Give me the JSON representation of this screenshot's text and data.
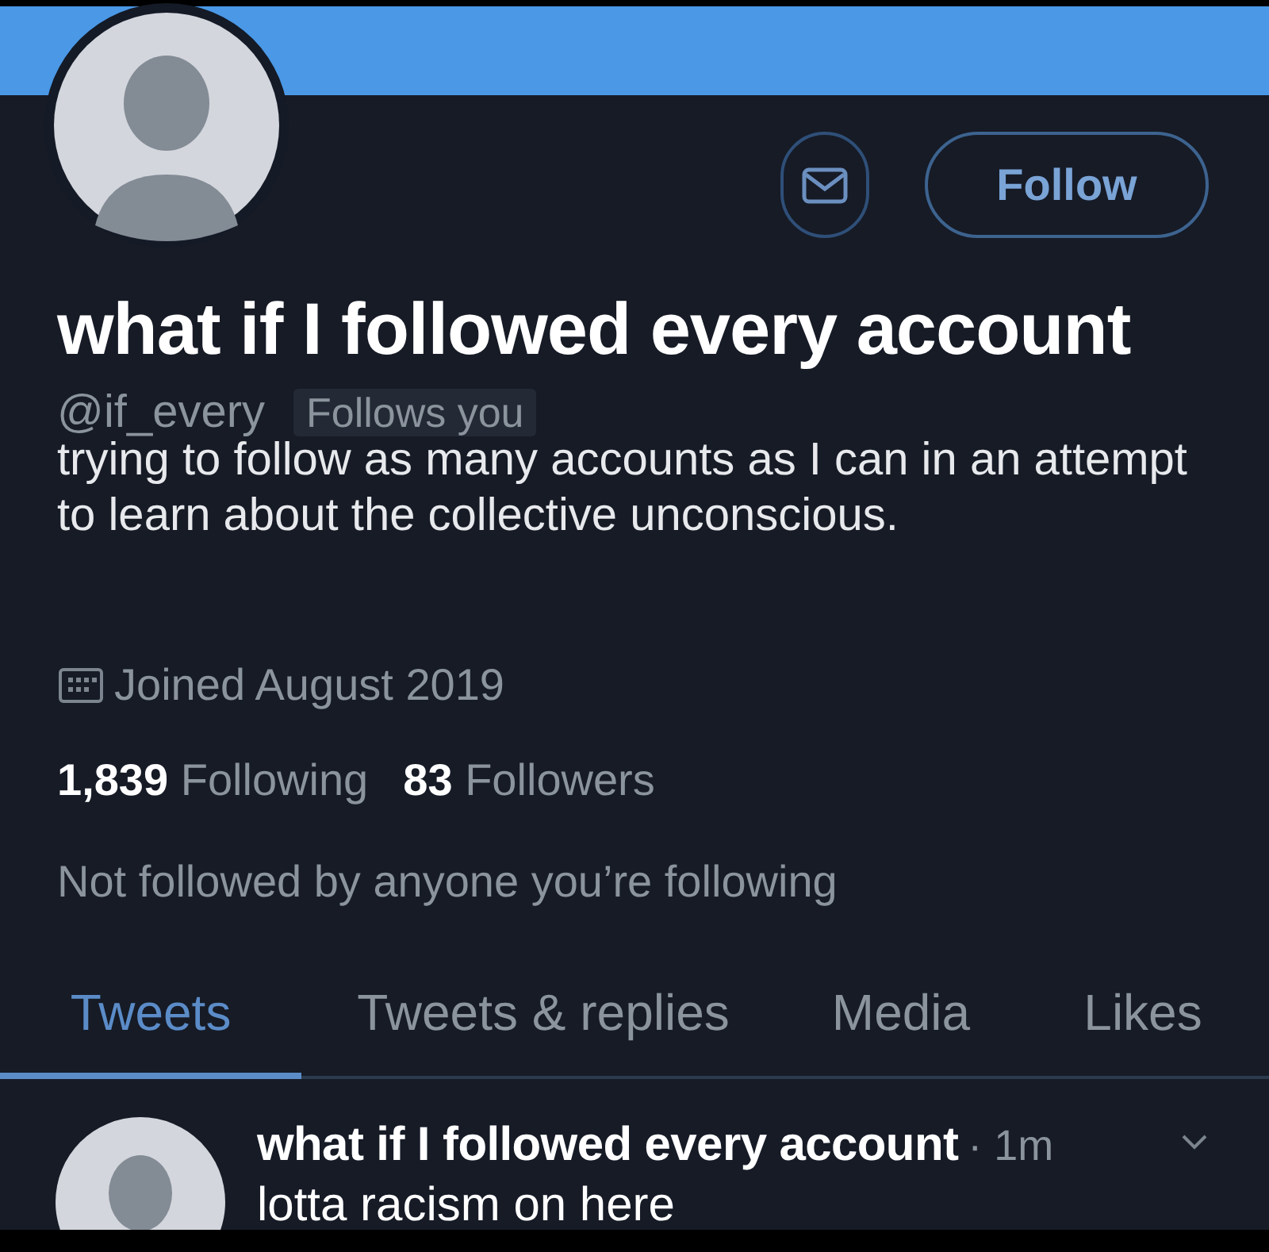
{
  "profile": {
    "name": "what if I followed every account",
    "handle": "@if_every",
    "follows_you_badge": "Follows you",
    "bio": "trying to follow as many accounts as I can in an attempt to learn about the collective unconscious.",
    "joined": "Joined August 2019",
    "stats": [
      {
        "count": "1,839",
        "label": "Following"
      },
      {
        "count": "83",
        "label": "Followers"
      }
    ],
    "mutuals_note": "Not followed by anyone you’re following"
  },
  "actions": {
    "follow_button": "Follow"
  },
  "tabs": [
    {
      "label": "Tweets",
      "selected": true
    },
    {
      "label": "Tweets & replies",
      "selected": false
    },
    {
      "label": "Media",
      "selected": false
    },
    {
      "label": "Likes",
      "selected": false
    }
  ],
  "tweets": [
    {
      "author": "what if I followed every account",
      "time": "· 1m",
      "text": "lotta racism on here"
    }
  ]
}
